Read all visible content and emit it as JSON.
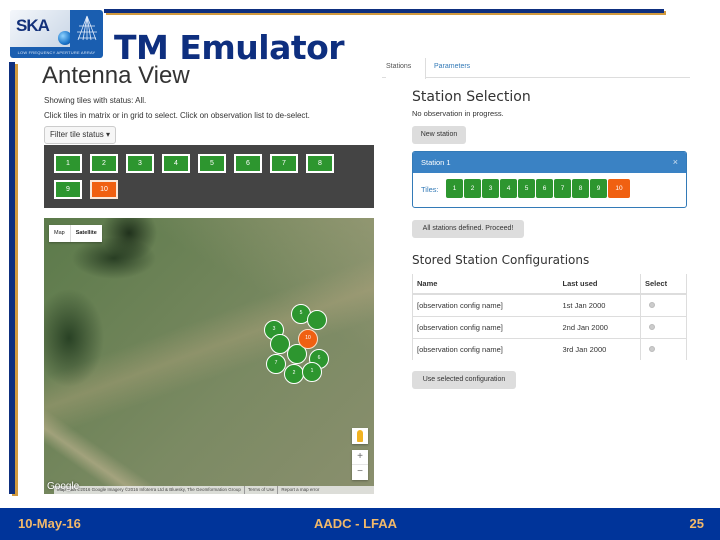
{
  "slide": {
    "title": "TM Emulator",
    "logo": {
      "name": "SKA",
      "tagline": "LOW FREQUENCY APERTURE ARRAY"
    },
    "footer": {
      "date": "10-May-16",
      "center": "AADC - LFAA",
      "page": "25"
    },
    "colors": {
      "brand_blue": "#0e2f7f",
      "accent_gold": "#d29a3e",
      "footer_bg": "#00349a",
      "footer_text": "#f2b96a"
    }
  },
  "antenna_view": {
    "title": "Antenna View",
    "status_line": "Showing tiles with status: All.",
    "instructions": "Click tiles in matrix or in grid to select. Click on observation list to de-select.",
    "filter_button": "Filter tile status",
    "tiles": [
      {
        "label": "1",
        "status": "ok"
      },
      {
        "label": "2",
        "status": "ok"
      },
      {
        "label": "3",
        "status": "ok"
      },
      {
        "label": "4",
        "status": "ok"
      },
      {
        "label": "5",
        "status": "ok"
      },
      {
        "label": "6",
        "status": "ok"
      },
      {
        "label": "7",
        "status": "ok"
      },
      {
        "label": "8",
        "status": "ok"
      },
      {
        "label": "9",
        "status": "ok"
      },
      {
        "label": "10",
        "status": "selected"
      }
    ],
    "tile_colors": {
      "ok": "#2d962f",
      "selected": "#f06011"
    },
    "map": {
      "type_options": [
        "Map",
        "Satellite"
      ],
      "selected_type": "Satellite",
      "markers": [
        "5",
        "9",
        "3",
        "10",
        "6",
        "7",
        "1",
        "2"
      ],
      "google_label": "Google",
      "attribution": "Map data ©2016 Google Imagery ©2016 Infoterra Ltd & Bluesky, The GeoInformation Group",
      "terms": "Terms of Use",
      "report": "Report a map error",
      "zoom_in": "+",
      "zoom_out": "−"
    }
  },
  "station_panel": {
    "tabs": [
      {
        "label": "Stations",
        "active": true
      },
      {
        "label": "Parameters",
        "active": false
      }
    ],
    "title": "Station Selection",
    "status": "No observation in progress.",
    "new_station_button": "New station",
    "station": {
      "name": "Station 1",
      "tiles_label": "Tiles:",
      "close": "×",
      "tiles": [
        {
          "label": "1",
          "status": "ok"
        },
        {
          "label": "2",
          "status": "ok"
        },
        {
          "label": "3",
          "status": "ok"
        },
        {
          "label": "4",
          "status": "ok"
        },
        {
          "label": "5",
          "status": "ok"
        },
        {
          "label": "6",
          "status": "ok"
        },
        {
          "label": "7",
          "status": "ok"
        },
        {
          "label": "8",
          "status": "ok"
        },
        {
          "label": "9",
          "status": "ok"
        },
        {
          "label": "10",
          "status": "selected"
        }
      ]
    },
    "proceed_button": "All stations defined. Proceed!",
    "stored_title": "Stored Station Configurations",
    "table": {
      "headers": [
        "Name",
        "Last used",
        "Select"
      ],
      "rows": [
        {
          "name": "[observation config name]",
          "last_used": "1st Jan 2000",
          "selected": false
        },
        {
          "name": "[observation config name]",
          "last_used": "2nd Jan 2000",
          "selected": false
        },
        {
          "name": "[observation config name]",
          "last_used": "3rd Jan 2000",
          "selected": false
        }
      ]
    },
    "use_config_button": "Use selected configuration"
  }
}
